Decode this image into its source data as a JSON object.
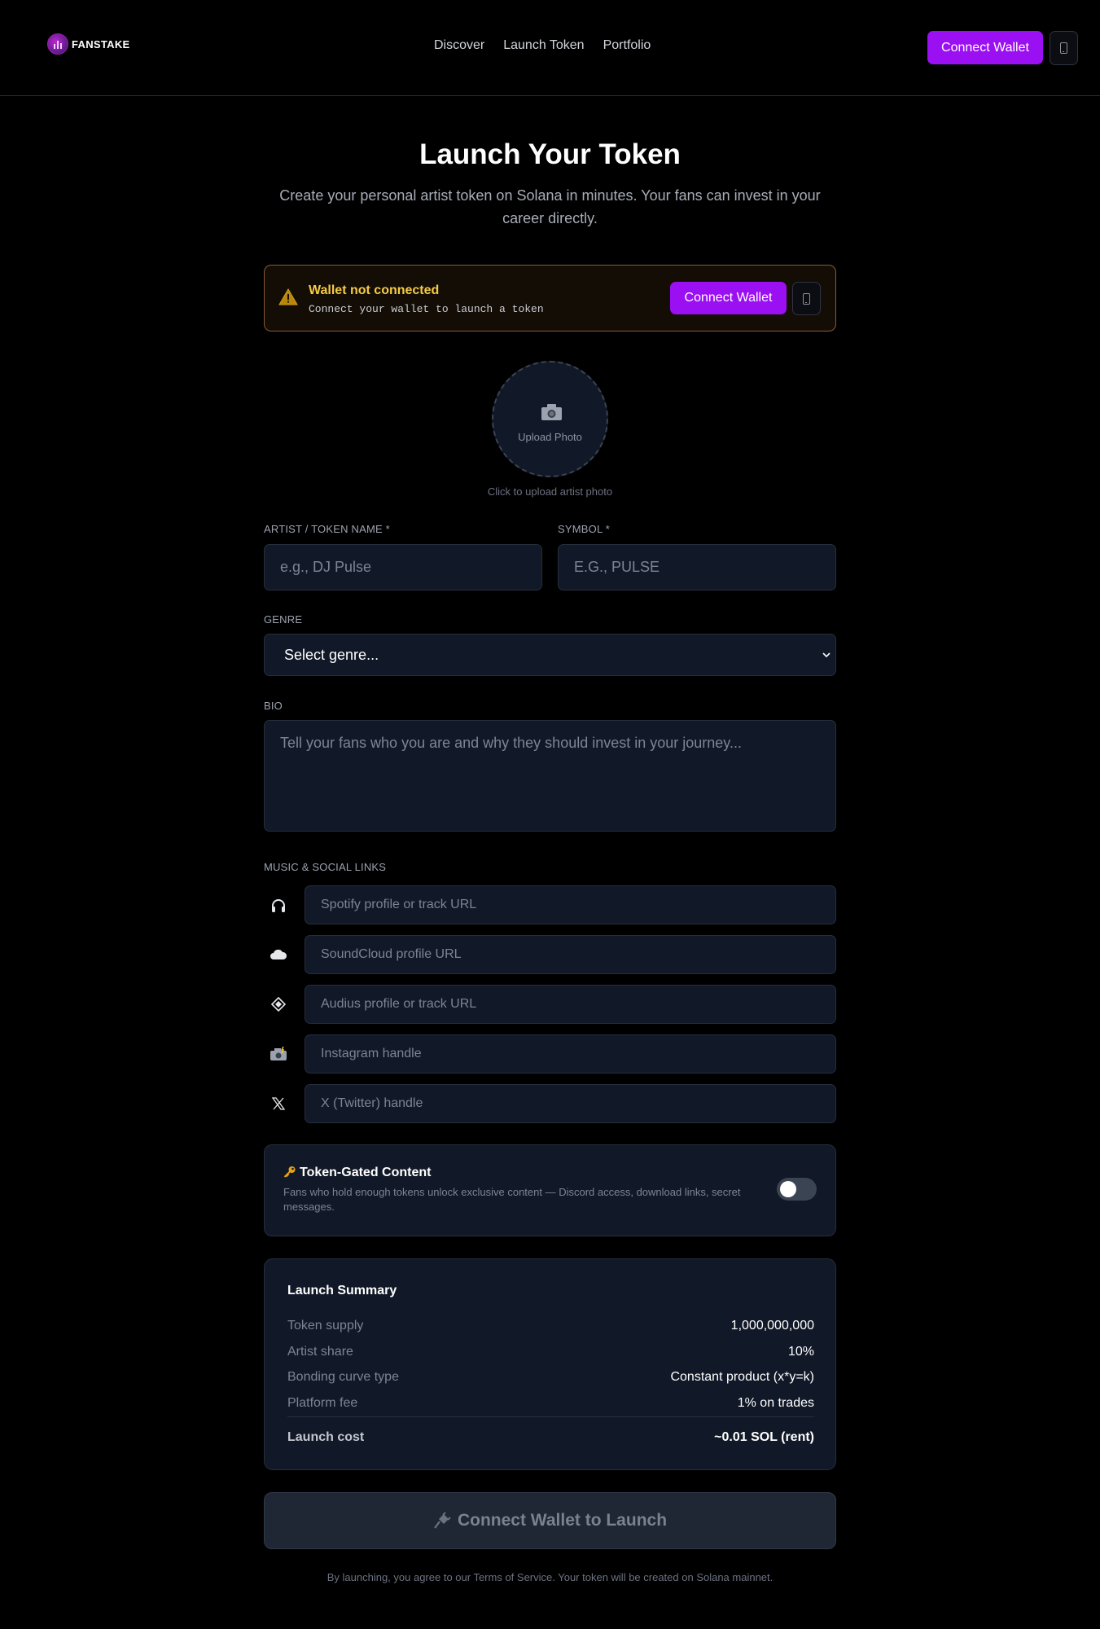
{
  "header": {
    "brand": "FANSTAKE",
    "nav": [
      "Discover",
      "Launch Token",
      "Portfolio"
    ],
    "connect_label": "Connect Wallet"
  },
  "page": {
    "title": "Launch Your Token",
    "subtitle": "Create your personal artist token on Solana in minutes. Your fans can invest in your career directly."
  },
  "alert": {
    "title": "Wallet not connected",
    "text": "Connect your wallet to launch a token",
    "connect_label": "Connect Wallet"
  },
  "upload": {
    "label": "Upload Photo",
    "hint": "Click to upload artist photo"
  },
  "form": {
    "name_label": "Artist / Token Name *",
    "name_placeholder": "e.g., DJ Pulse",
    "symbol_label": "Symbol *",
    "symbol_placeholder": "E.G., PULSE",
    "genre_label": "Genre",
    "genre_selected": "Select genre...",
    "bio_label": "Bio",
    "bio_placeholder": "Tell your fans who you are and why they should invest in your journey...",
    "links_label": "Music & Social Links",
    "links": [
      {
        "icon": "headphones-icon",
        "placeholder": "Spotify profile or track URL"
      },
      {
        "icon": "cloud-icon",
        "placeholder": "SoundCloud profile URL"
      },
      {
        "icon": "diamond-icon",
        "placeholder": "Audius profile or track URL"
      },
      {
        "icon": "camera-flash-icon",
        "placeholder": "Instagram handle"
      },
      {
        "icon": "x-logo-icon",
        "placeholder": "X (Twitter) handle"
      }
    ]
  },
  "gated": {
    "title": "Token-Gated Content",
    "description": "Fans who hold enough tokens unlock exclusive content — Discord access, download links, secret messages.",
    "enabled": false
  },
  "summary": {
    "title": "Launch Summary",
    "rows": [
      {
        "label": "Token supply",
        "value": "1,000,000,000"
      },
      {
        "label": "Artist share",
        "value": "10%"
      },
      {
        "label": "Bonding curve type",
        "value": "Constant product (x*y=k)"
      },
      {
        "label": "Platform fee",
        "value": "1% on trades"
      }
    ],
    "total": {
      "label": "Launch cost",
      "value": "~0.01 SOL (rent)"
    }
  },
  "launch": {
    "label": "Connect Wallet to Launch"
  },
  "footer": {
    "note": "By launching, you agree to our Terms of Service. Your token will be created on Solana mainnet."
  },
  "colors": {
    "accent": "#9b10f2",
    "alert_title": "#f5cb45",
    "background": "#000000",
    "card": "#111827"
  }
}
